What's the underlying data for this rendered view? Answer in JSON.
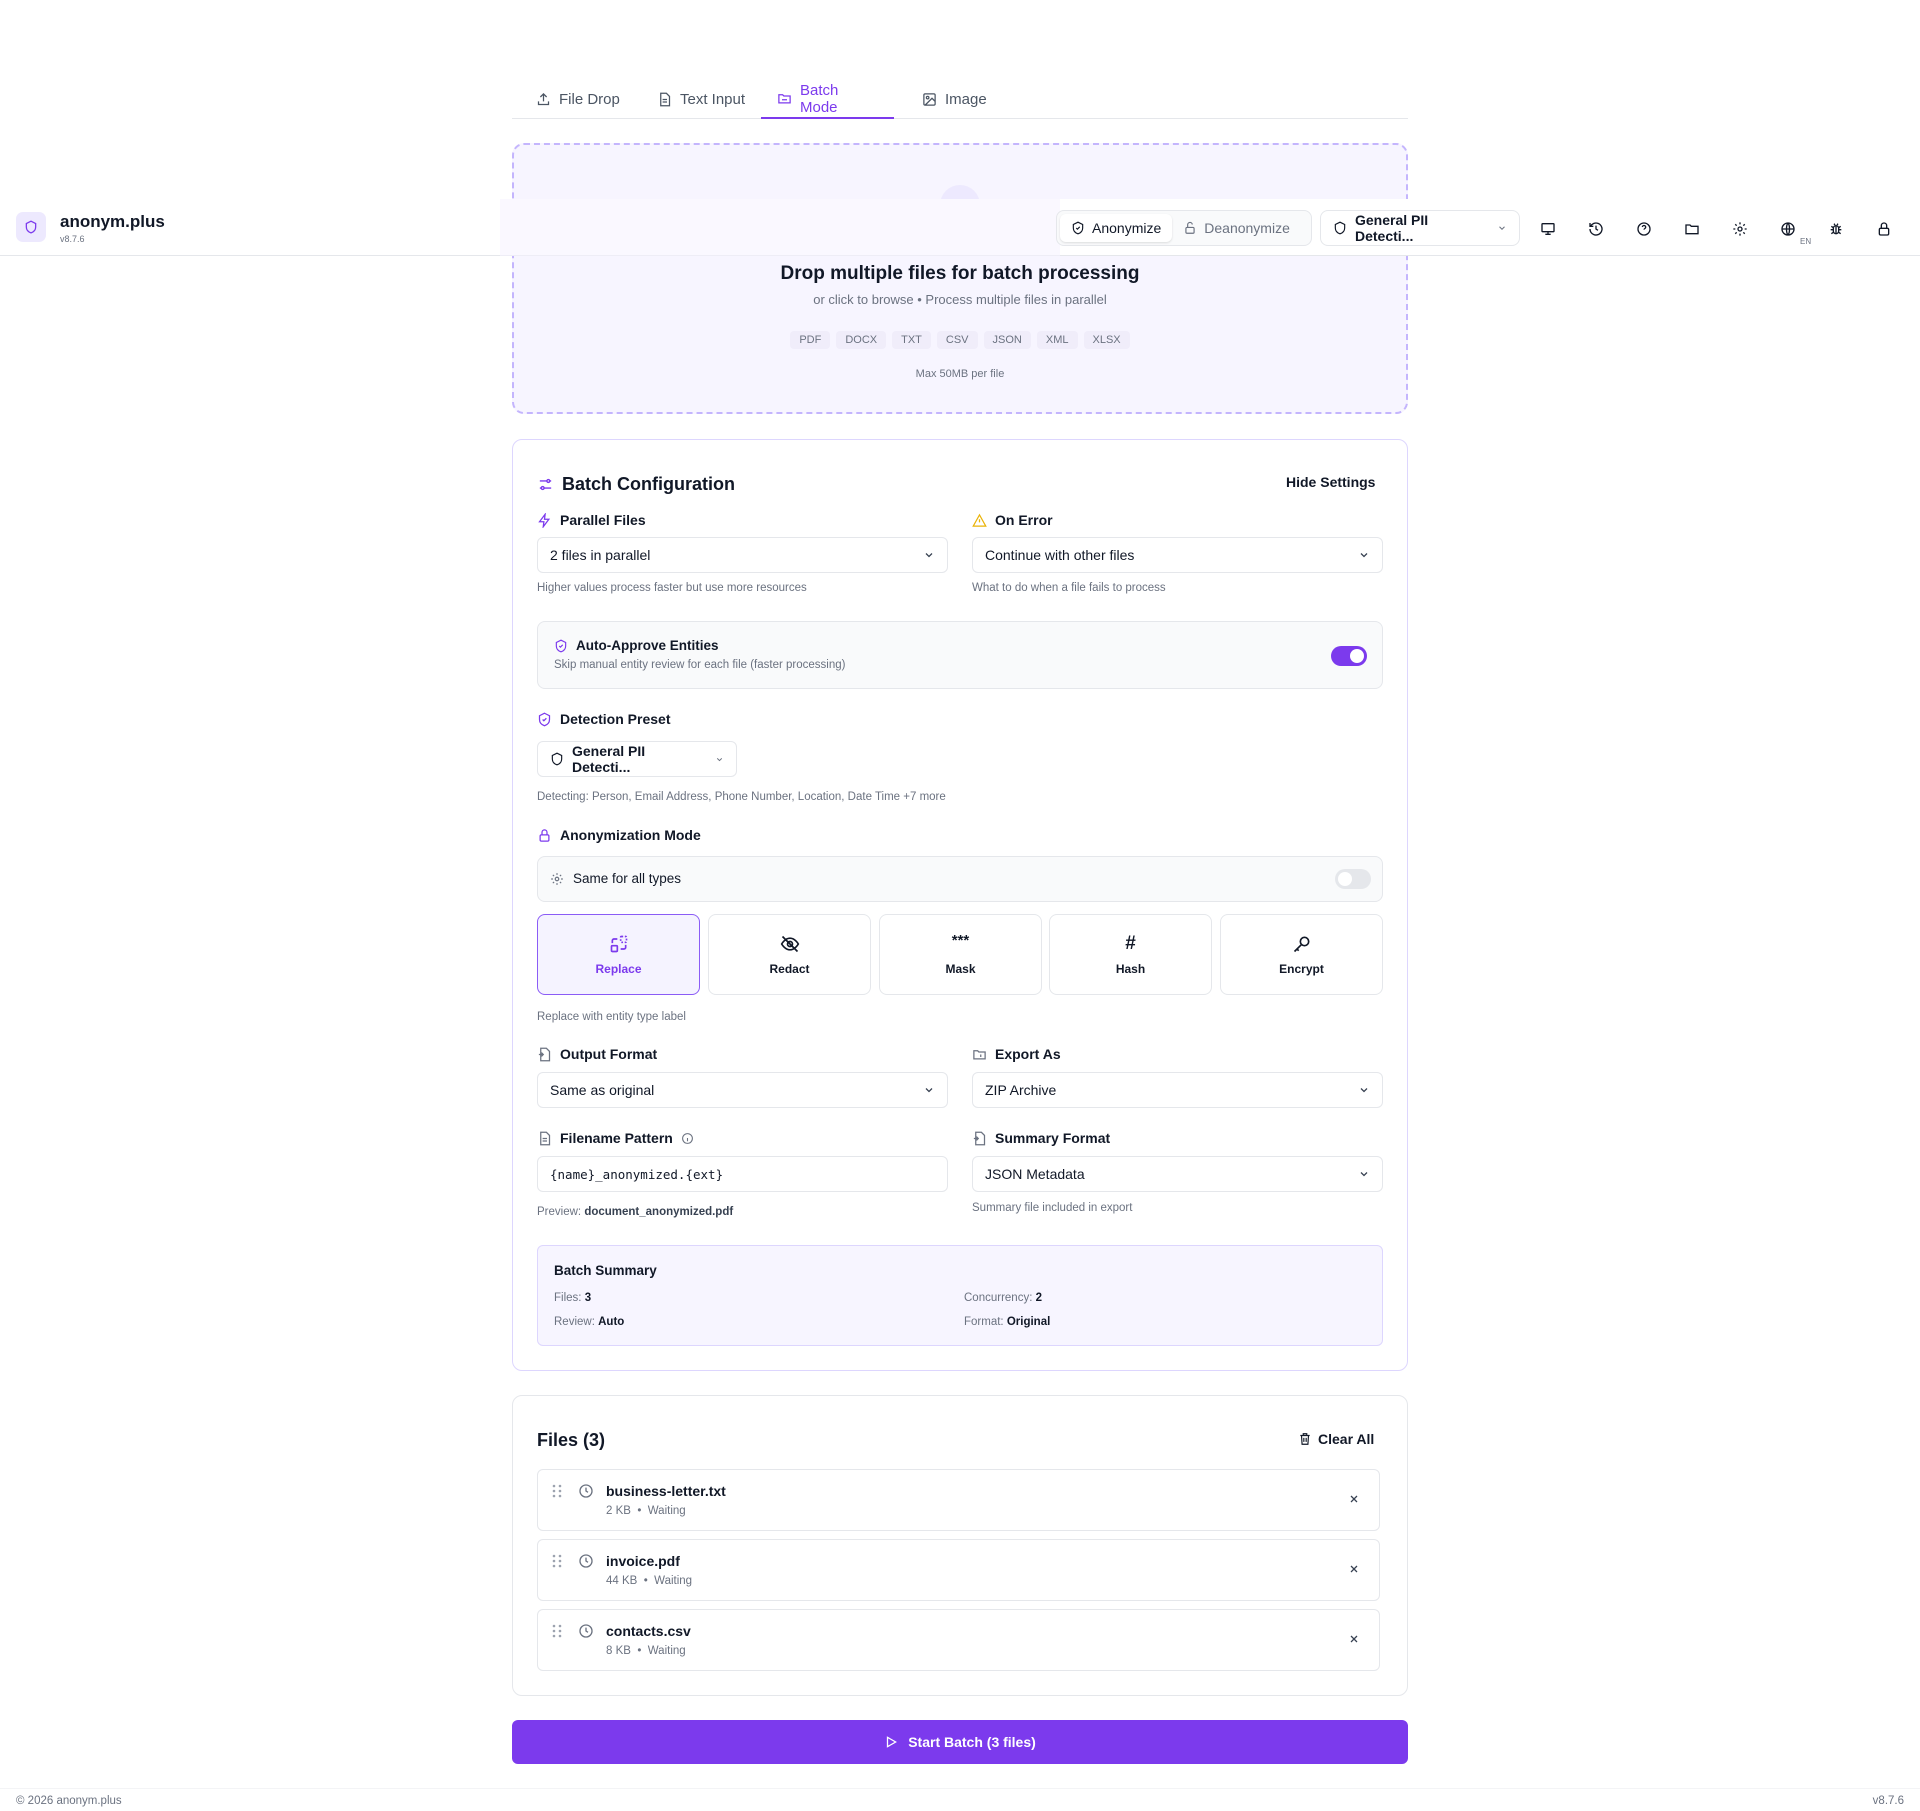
{
  "header": {
    "app_name": "anonym.plus",
    "version": "v8.7.6",
    "mode_anonymize": "Anonymize",
    "mode_deanonymize": "Deanonymize",
    "preset_label": "General PII Detecti...",
    "language_badge": "EN",
    "icons": [
      "monitor-icon",
      "history-icon",
      "help-icon",
      "folder-icon",
      "settings-icon",
      "globe-icon",
      "bug-icon",
      "lock-icon"
    ]
  },
  "tabs": [
    {
      "label": "File Drop",
      "icon": "upload-icon"
    },
    {
      "label": "Text Input",
      "icon": "document-icon"
    },
    {
      "label": "Batch Mode",
      "icon": "folders-icon"
    },
    {
      "label": "Image",
      "icon": "image-icon"
    }
  ],
  "dropzone": {
    "title": "Drop multiple files for batch processing",
    "subtitle": "or click to browse • Process multiple files in parallel",
    "formats": [
      "PDF",
      "DOCX",
      "TXT",
      "CSV",
      "JSON",
      "XML",
      "XLSX"
    ],
    "max_size": "Max 50MB per file"
  },
  "config": {
    "title": "Batch Configuration",
    "hide_settings": "Hide Settings",
    "parallel_label": "Parallel Files",
    "parallel_value": "2 files in parallel",
    "parallel_hint": "Higher values process faster but use more resources",
    "on_error_label": "On Error",
    "on_error_value": "Continue with other files",
    "on_error_hint": "What to do when a file fails to process",
    "auto_approve_title": "Auto-Approve Entities",
    "auto_approve_desc": "Skip manual entity review for each file (faster processing)",
    "auto_approve_on": true,
    "detection_label": "Detection Preset",
    "detection_value": "General PII Detecti...",
    "detection_hint": "Detecting: Person, Email Address, Phone Number, Location, Date Time +7 more",
    "anon_label": "Anonymization Mode",
    "same_for_all": "Same for all types",
    "same_for_all_on": false,
    "modes": [
      {
        "label": "Replace",
        "icon": "replace-icon",
        "selected": true
      },
      {
        "label": "Redact",
        "icon": "eye-off-icon",
        "selected": false
      },
      {
        "label": "Mask",
        "icon": "asterisks-icon",
        "glyph": "***",
        "selected": false
      },
      {
        "label": "Hash",
        "icon": "hash-icon",
        "glyph": "#",
        "selected": false
      },
      {
        "label": "Encrypt",
        "icon": "key-icon",
        "selected": false
      }
    ],
    "mode_hint": "Replace with entity type label",
    "output_label": "Output Format",
    "output_value": "Same as original",
    "export_label": "Export As",
    "export_value": "ZIP Archive",
    "filename_label": "Filename Pattern",
    "filename_value": "{name}_anonymized.{ext}",
    "preview_prefix": "Preview:",
    "preview_value": "document_anonymized.pdf",
    "summary_format_label": "Summary Format",
    "summary_format_value": "JSON Metadata",
    "summary_format_hint": "Summary file included in export",
    "summary": {
      "title": "Batch Summary",
      "files_label": "Files:",
      "files_value": "3",
      "concurrency_label": "Concurrency:",
      "concurrency_value": "2",
      "review_label": "Review:",
      "review_value": "Auto",
      "format_label": "Format:",
      "format_value": "Original"
    }
  },
  "files": {
    "title": "Files (3)",
    "clear_all": "Clear All",
    "items": [
      {
        "name": "business-letter.txt",
        "size": "2 KB",
        "status": "Waiting"
      },
      {
        "name": "invoice.pdf",
        "size": "44 KB",
        "status": "Waiting"
      },
      {
        "name": "contacts.csv",
        "size": "8 KB",
        "status": "Waiting"
      }
    ]
  },
  "start_button": "Start Batch (3 files)",
  "footer": {
    "copyright": "© 2026 anonym.plus",
    "version": "v8.7.6"
  },
  "colors": {
    "accent": "#7c3aed",
    "accent_light": "#f5f3ff",
    "warning": "#eab308"
  }
}
